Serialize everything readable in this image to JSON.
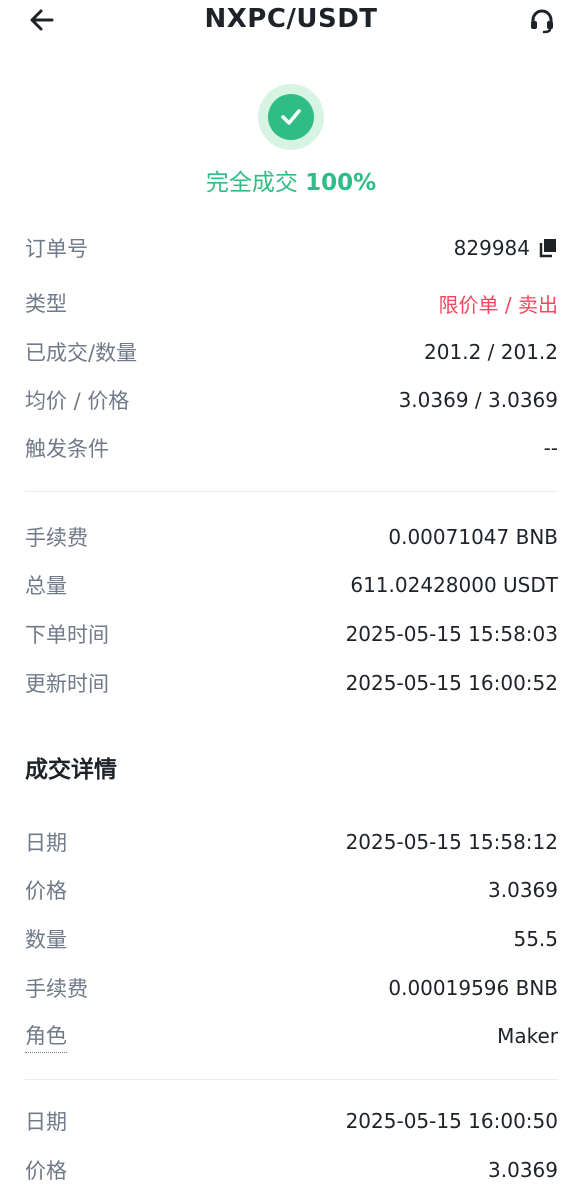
{
  "header": {
    "title": "NXPC/USDT"
  },
  "status": {
    "text": "完全成交",
    "percent": "100%"
  },
  "order_info": [
    {
      "label": "订单号",
      "value": "829984"
    },
    {
      "label": "类型",
      "value": "限价单 / 卖出"
    },
    {
      "label": "已成交/数量",
      "value": "201.2 / 201.2"
    },
    {
      "label": "均价 / 价格",
      "value": "3.0369 / 3.0369"
    },
    {
      "label": "触发条件",
      "value": "--"
    }
  ],
  "order_meta": [
    {
      "label": "手续费",
      "value": "0.00071047 BNB"
    },
    {
      "label": "总量",
      "value": "611.02428000 USDT"
    },
    {
      "label": "下单时间",
      "value": "2025-05-15 15:58:03"
    },
    {
      "label": "更新时间",
      "value": "2025-05-15 16:00:52"
    }
  ],
  "trade_details": {
    "title": "成交详情",
    "trades": [
      {
        "rows": [
          {
            "label": "日期",
            "value": "2025-05-15 15:58:12"
          },
          {
            "label": "价格",
            "value": "3.0369"
          },
          {
            "label": "数量",
            "value": "55.5"
          },
          {
            "label": "手续费",
            "value": "0.00019596 BNB"
          },
          {
            "label": "角色",
            "value": "Maker"
          }
        ]
      },
      {
        "rows": [
          {
            "label": "日期",
            "value": "2025-05-15 16:00:50"
          },
          {
            "label": "价格",
            "value": "3.0369"
          }
        ]
      }
    ]
  },
  "colors": {
    "success": "#2ebd85",
    "sell": "#f6465d",
    "label": "#707a8a",
    "text": "#1e2329"
  },
  "icons": {
    "back": "back-arrow-icon",
    "support": "headset-icon",
    "status": "check-icon",
    "copy": "copy-icon"
  }
}
